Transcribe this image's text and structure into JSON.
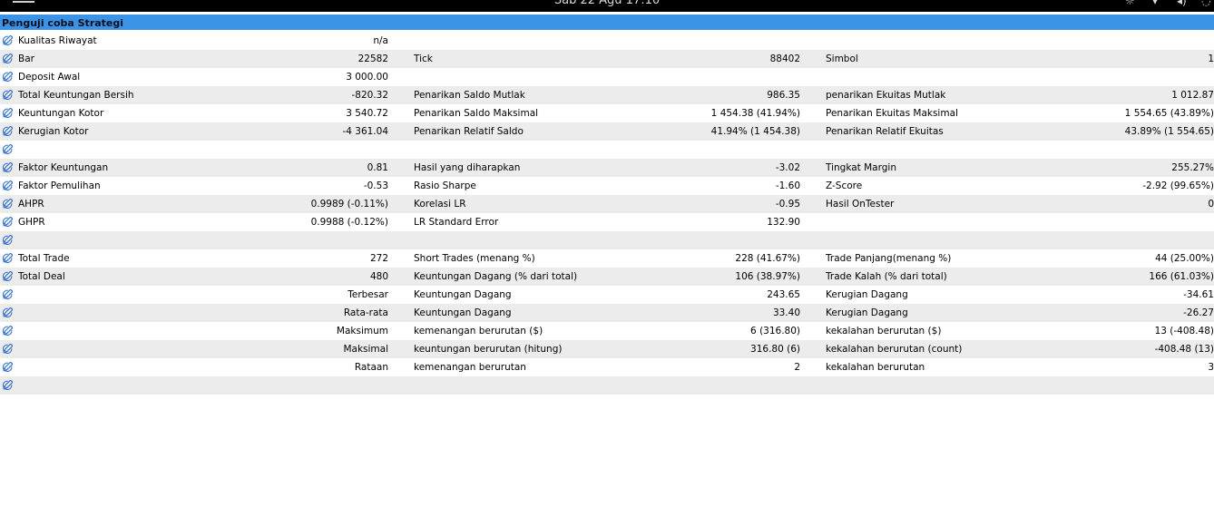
{
  "topbar": {
    "clock": "Sab 22 Agu 17:10"
  },
  "title": "Penguji coba Strategi",
  "rows": [
    {
      "c1": "Kualitas Riwayat",
      "v1": "n/a",
      "c2": "",
      "v2": "",
      "c3": "",
      "v3": ""
    },
    {
      "c1": "Bar",
      "v1": "22582",
      "c2": "Tick",
      "v2": "88402",
      "c3": "Simbol",
      "v3": "1"
    },
    {
      "c1": "Deposit Awal",
      "v1": "3 000.00",
      "c2": "",
      "v2": "",
      "c3": "",
      "v3": ""
    },
    {
      "c1": "Total Keuntungan Bersih",
      "v1": "-820.32",
      "c2": "Penarikan Saldo Mutlak",
      "v2": "986.35",
      "c3": "penarikan Ekuitas Mutlak",
      "v3": "1 012.87"
    },
    {
      "c1": "Keuntungan Kotor",
      "v1": "3 540.72",
      "c2": "Penarikan Saldo Maksimal",
      "v2": "1 454.38 (41.94%)",
      "c3": "Penarikan Ekuitas Maksimal",
      "v3": "1 554.65 (43.89%)"
    },
    {
      "c1": "Kerugian Kotor",
      "v1": "-4 361.04",
      "c2": "Penarikan Relatif Saldo",
      "v2": "41.94% (1 454.38)",
      "c3": "Penarikan Relatif Ekuitas",
      "v3": "43.89% (1 554.65)"
    },
    {
      "c1": "",
      "v1": "",
      "c2": "",
      "v2": "",
      "c3": "",
      "v3": ""
    },
    {
      "c1": "Faktor Keuntungan",
      "v1": "0.81",
      "c2": "Hasil yang diharapkan",
      "v2": "-3.02",
      "c3": "Tingkat Margin",
      "v3": "255.27%"
    },
    {
      "c1": "Faktor Pemulihan",
      "v1": "-0.53",
      "c2": "Rasio Sharpe",
      "v2": "-1.60",
      "c3": "Z-Score",
      "v3": "-2.92 (99.65%)"
    },
    {
      "c1": "AHPR",
      "v1": "0.9989 (-0.11%)",
      "c2": "Korelasi LR",
      "v2": "-0.95",
      "c3": "Hasil OnTester",
      "v3": "0"
    },
    {
      "c1": "GHPR",
      "v1": "0.9988 (-0.12%)",
      "c2": "LR Standard Error",
      "v2": "132.90",
      "c3": "",
      "v3": ""
    },
    {
      "c1": "",
      "v1": "",
      "c2": "",
      "v2": "",
      "c3": "",
      "v3": ""
    },
    {
      "c1": "Total Trade",
      "v1": "272",
      "c2": "Short Trades (menang %)",
      "v2": "228 (41.67%)",
      "c3": "Trade Panjang(menang %)",
      "v3": "44 (25.00%)"
    },
    {
      "c1": "Total Deal",
      "v1": "480",
      "c2": "Keuntungan Dagang (% dari total)",
      "v2": "106 (38.97%)",
      "c3": "Trade Kalah (% dari total)",
      "v3": "166 (61.03%)"
    },
    {
      "c1": "",
      "v1": "Terbesar",
      "c2": "Keuntungan Dagang",
      "v2": "243.65",
      "c3": "Kerugian Dagang",
      "v3": "-34.61"
    },
    {
      "c1": "",
      "v1": "Rata-rata",
      "c2": "Keuntungan Dagang",
      "v2": "33.40",
      "c3": "Kerugian Dagang",
      "v3": "-26.27"
    },
    {
      "c1": "",
      "v1": "Maksimum",
      "c2": "kemenangan berurutan ($)",
      "v2": "6 (316.80)",
      "c3": "kekalahan berurutan ($)",
      "v3": "13 (-408.48)"
    },
    {
      "c1": "",
      "v1": "Maksimal",
      "c2": "keuntungan berurutan (hitung)",
      "v2": "316.80 (6)",
      "c3": "kekalahan berurutan (count)",
      "v3": "-408.48 (13)"
    },
    {
      "c1": "",
      "v1": "Rataan",
      "c2": "kemenangan berurutan",
      "v2": "2",
      "c3": "kekalahan berurutan",
      "v3": "3"
    },
    {
      "c1": "",
      "v1": "",
      "c2": "",
      "v2": "",
      "c3": "",
      "v3": ""
    }
  ],
  "icons": {
    "row": "edit-pencil-icon",
    "menu": "menu-icon"
  },
  "colors": {
    "title_bg": "#3a93e6",
    "alt_row": "#ececec",
    "icon": "#2d6fd1"
  }
}
